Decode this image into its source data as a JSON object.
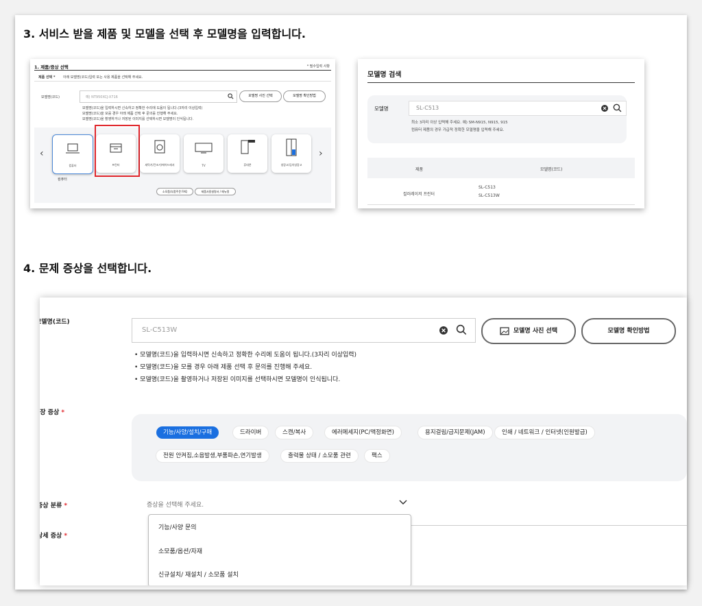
{
  "step3": {
    "heading": "3. 서비스 받을 제품 및 모델을 선택 후 모델명을 입력합니다.",
    "left": {
      "section_title": "1. 제품/증상 선택",
      "required_note": "* 필수입력 사항",
      "product_row_label": "제품 선택 *",
      "product_row_text": "아래 모델명(코드)입력 또는 사용 제품을 선택해 주세요.",
      "model_label": "모델명(코드)",
      "search_placeholder": "예) NT950XCJ-X716",
      "photo_button": "모델명 사진 선택",
      "howto_button": "모델명 확인방법",
      "notes": [
        "모델명(코드)을 입력하시면 신속하고 정확한 수리에 도움이 됩니다.(3자리 이상입력)",
        "모델명(코드)을 모를 경우 아래 제품 선택 후 문의를 진행해 주세요.",
        "모델명(코드)을 촬영하거나 저장된 이미지를 선택하시면 모델명이 인식됩니다."
      ],
      "products": [
        "컴퓨터",
        "프린터",
        "세탁기/건조기/에어드레서",
        "TV",
        "휴대폰",
        "냉장고/김치냉장고"
      ],
      "selected_label": "컴퓨터",
      "prev_arrow": "‹",
      "next_arrow": "›",
      "bottom_buttons": [
        "소모품/부품주문 FAQ",
        "제품사용설명서 / 메뉴얼"
      ]
    },
    "right": {
      "title": "모델명 검색",
      "label": "모델명",
      "input_value": "SL-C513",
      "notes": [
        "최소 3자리 이상 입력해 주세요. 예) SM-N915, N915, 915",
        "컴퓨터 제품의 경우 가급적 정확한 모델명을 입력해 주세요."
      ],
      "table_headers": [
        "제품",
        "모델명(코드)"
      ],
      "result_product": "컬러레이저 프린터",
      "result_models": [
        "SL-C513",
        "SL-C513W"
      ]
    }
  },
  "step4": {
    "heading": "4. 문제 증상을 선택합니다.",
    "model_label": "모델명(코드)",
    "model_value": "SL-C513W",
    "photo_button": "모델명 사진 선택",
    "howto_button": "모델명 확인방법",
    "notes": [
      "모델명(코드)을 입력하시면 신속하고 정확한 수리에 도움이 됩니다.(3자리 이상입력)",
      "모델명(코드)을 모를 경우 아래 제품 선택 후 문의를 진행해 주세요.",
      "모델명(코드)을 촬영하거나 저장된 이미지를 선택하시면 모델명이 인식됩니다."
    ],
    "symptom_label": "고장 증상",
    "symptoms_row1": [
      "기능/사양/설치/구매",
      "드라이버",
      "스캔/복사",
      "에러메세지(PC/액정화면)",
      "용지걸림/급지문제(JAM)",
      "인쇄 / 네트워크 / 인터넷(인원발급)"
    ],
    "symptoms_row2": [
      "전원 안켜짐,소음발생,부품파손,연기발생",
      "출력물 상태 / 소모품 관련",
      "팩스"
    ],
    "category_label": "증상 분류",
    "category_placeholder": "증상을 선택해 주세요.",
    "dropdown_options": [
      "기능/사양 문의",
      "소모품/옵션/자재",
      "신규설치/ 재설치 / 소모품 설치"
    ],
    "detail_label": "상세 증상",
    "required_mark": "*",
    "colors": {
      "accent": "#1a6fe0",
      "highlight": "#e0252b"
    }
  }
}
